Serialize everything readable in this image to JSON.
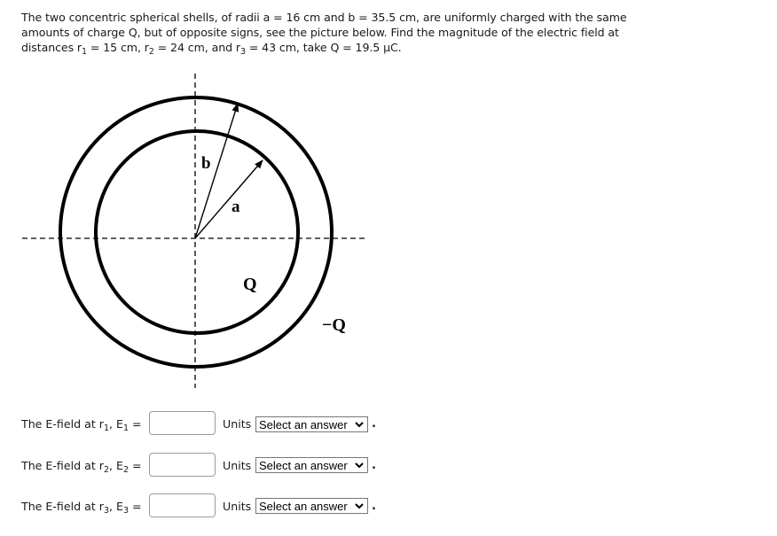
{
  "question": {
    "part1": "The two concentric spherical shells, of radii a = 16 cm and b = 35.5 cm, are uniformly charged with the same amounts of charge Q, but of opposite signs, see the picture below. Find the magnitude of the electric field at distances r",
    "sub1": "1",
    "part2": " = 15 cm, r",
    "sub2": "2",
    "part3": " = 24 cm, and r",
    "sub3": "3",
    "part4": " = 43 cm, take Q = 19.5 μC."
  },
  "figure": {
    "label_b": "b",
    "label_a": "a",
    "label_inner_charge": "Q",
    "label_outer_charge": "−Q"
  },
  "answers": [
    {
      "prefix": "The E-field at r",
      "r_sub": "1",
      "mid": ", E",
      "e_sub": "1",
      "suffix": " =",
      "value": "",
      "units_label": "Units",
      "units_selected": "Select an answer",
      "period": "."
    },
    {
      "prefix": "The E-field at r",
      "r_sub": "2",
      "mid": ", E",
      "e_sub": "2",
      "suffix": " =",
      "value": "",
      "units_label": "Units",
      "units_selected": "Select an answer",
      "period": "."
    },
    {
      "prefix": "The E-field at r",
      "r_sub": "3",
      "mid": ", E",
      "e_sub": "3",
      "suffix": " =",
      "value": "",
      "units_label": "Units",
      "units_selected": "Select an answer",
      "period": "."
    }
  ]
}
